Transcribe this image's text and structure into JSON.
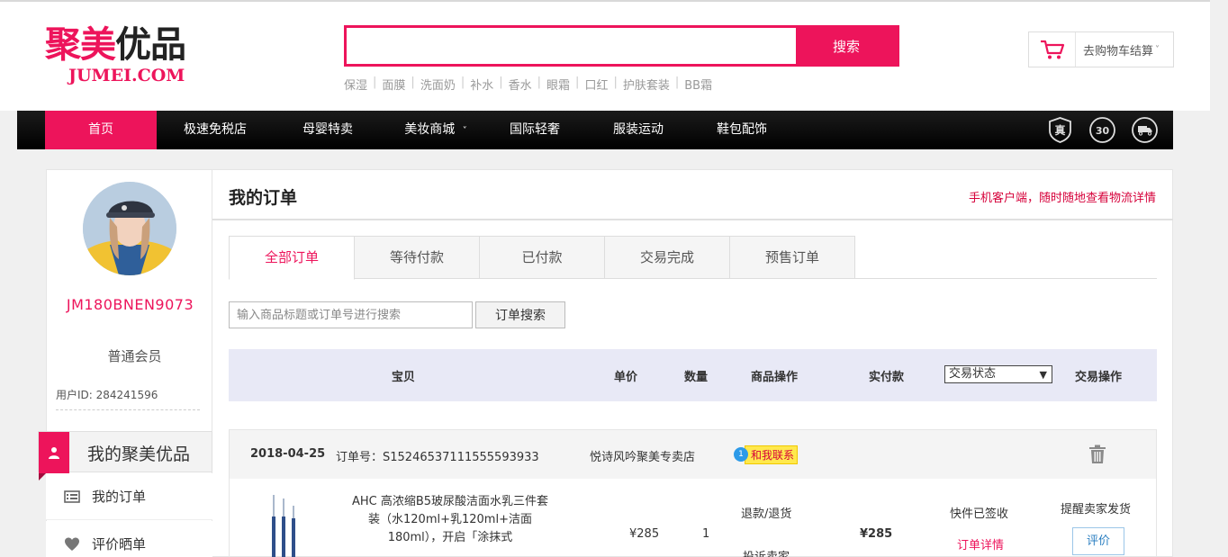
{
  "header": {
    "logo_cn_pink": "聚美",
    "logo_cn_dark": "优品",
    "logo_en": "JUMEI.COM",
    "search": {
      "value": "",
      "placeholder": "",
      "button": "搜索"
    },
    "hot_words": [
      "保湿",
      "面膜",
      "洗面奶",
      "补水",
      "香水",
      "眼霜",
      "口红",
      "护肤套装",
      "BB霜"
    ],
    "cart_label": "去购物车结算",
    "cart_caret": "˅"
  },
  "nav": {
    "items": [
      {
        "label": "首页",
        "active": true
      },
      {
        "label": "极速免税店"
      },
      {
        "label": "母婴特卖"
      },
      {
        "label": "美妆商城",
        "dropdown": "˅"
      },
      {
        "label": "国际轻奢"
      },
      {
        "label": "服装运动"
      },
      {
        "label": "鞋包配饰"
      }
    ],
    "badges": {
      "genuine": "真",
      "days": "30",
      "shipping": "shipping-truck-icon"
    }
  },
  "sidebar": {
    "username": "JM180BNEN9073",
    "member_level": "普通会员",
    "user_id": "用户ID: 284241596",
    "home_menu": "我的聚美优品",
    "menu": [
      {
        "label": "我的订单",
        "icon": "list-icon"
      },
      {
        "label": "评价晒单",
        "icon": "heart-icon"
      }
    ]
  },
  "main": {
    "title": "我的订单",
    "promo": "手机客户端，随时随地查看物流详情",
    "tabs": [
      "全部订单",
      "等待付款",
      "已付款",
      "交易完成",
      "预售订单"
    ],
    "order_search": {
      "placeholder": "输入商品标题或订单号进行搜索",
      "button": "订单搜索"
    },
    "table_header": {
      "product": "宝贝",
      "price": "单价",
      "quantity": "数量",
      "product_ops": "商品操作",
      "paid": "实付款",
      "status_select": "交易状态",
      "trade_ops": "交易操作"
    },
    "order": {
      "date": "2018-04-25",
      "order_no": "订单号：S15246537111555593933",
      "shop": "悦诗风吟聚美专卖店",
      "contact_badge": "1",
      "contact_label": "和我联系",
      "product_name": "AHC 高浓缩B5玻尿酸洁面水乳三件套装（水120ml+乳120ml+洁面180ml），开启「涂抹式",
      "price": "¥285",
      "quantity": "1",
      "op_refund": "退款/退货",
      "op_complain": "投诉卖家",
      "paid": "¥285",
      "status": "快件已签收",
      "detail_link": "订单详情",
      "remind": "提醒卖家发货",
      "review": "评价"
    }
  },
  "colors": {
    "brand": "#ed145b",
    "nav_bg": "#000000",
    "thead_bg": "#e8e9f6"
  }
}
